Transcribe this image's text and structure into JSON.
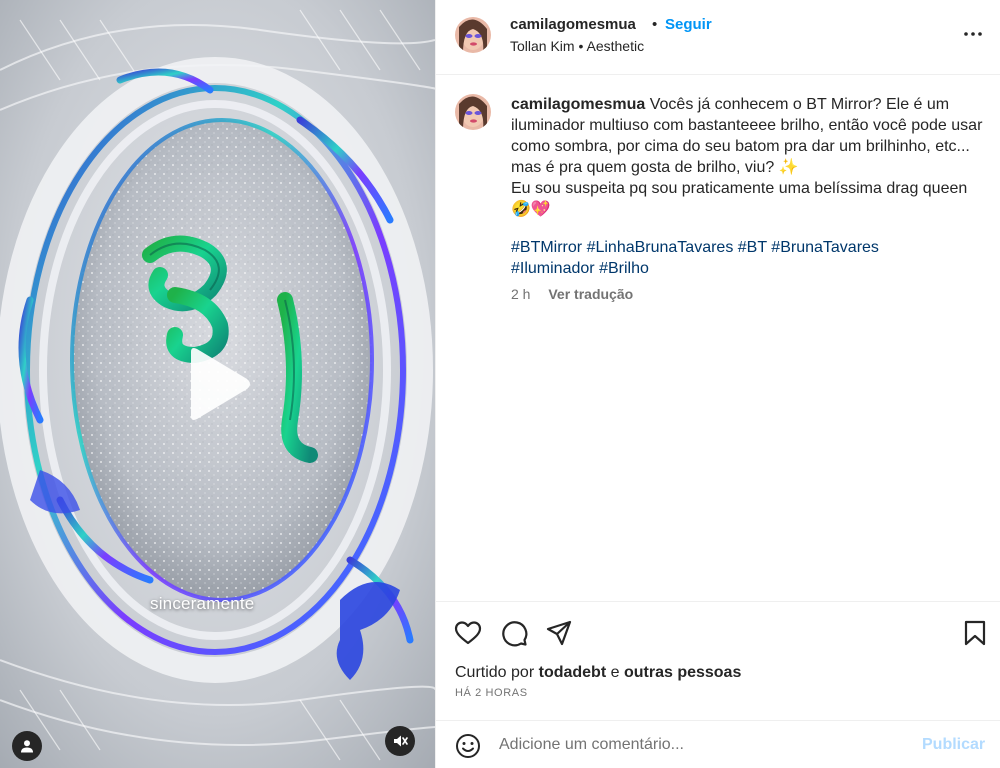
{
  "media": {
    "overlay_caption": "sinceramente",
    "icons": {
      "play": "play-icon",
      "user_tag": "user-tag-icon",
      "mute": "speaker-muted-icon"
    }
  },
  "post_header": {
    "username": "camilagomesmua",
    "separator": "•",
    "follow_label": "Seguir",
    "audio": "Tollan Kim • Aesthetic",
    "more_icon": "more-options-icon"
  },
  "caption": {
    "username": "camilagomesmua",
    "text_line_1": "Vocês já conhecem o BT Mirror? Ele é um iluminador multiuso com bastanteeee brilho, então você pode usar como sombra, por cima do seu batom pra dar um brilhinho, etc... mas é pra quem gosta de brilho, viu? ✨",
    "text_line_2": "Eu sou suspeita pq sou praticamente uma belíssima drag queen 🤣💖",
    "hashtags": [
      "#BTMirror",
      "#LinhaBrunaTavares",
      "#BT",
      "#BrunaTavares",
      "#Iluminador",
      "#Brilho"
    ],
    "time": "2 h",
    "translate_label": "Ver tradução"
  },
  "actions": {
    "icons": [
      "heart-icon",
      "comment-icon",
      "share-icon",
      "bookmark-icon"
    ]
  },
  "likes": {
    "prefix": "Curtido por",
    "user": "todadebt",
    "connector": "e",
    "others": "outras pessoas"
  },
  "timestamp": "HÁ 2 HORAS",
  "comment": {
    "placeholder": "Adicione um comentário...",
    "publish_label": "Publicar",
    "emoji_icon": "emoji-icon"
  },
  "colors": {
    "link_blue": "#0095f6",
    "hashtag_blue": "#00376b",
    "publish_disabled": "#b3dbff",
    "secondary_text": "#737373",
    "divider": "#efefef"
  }
}
